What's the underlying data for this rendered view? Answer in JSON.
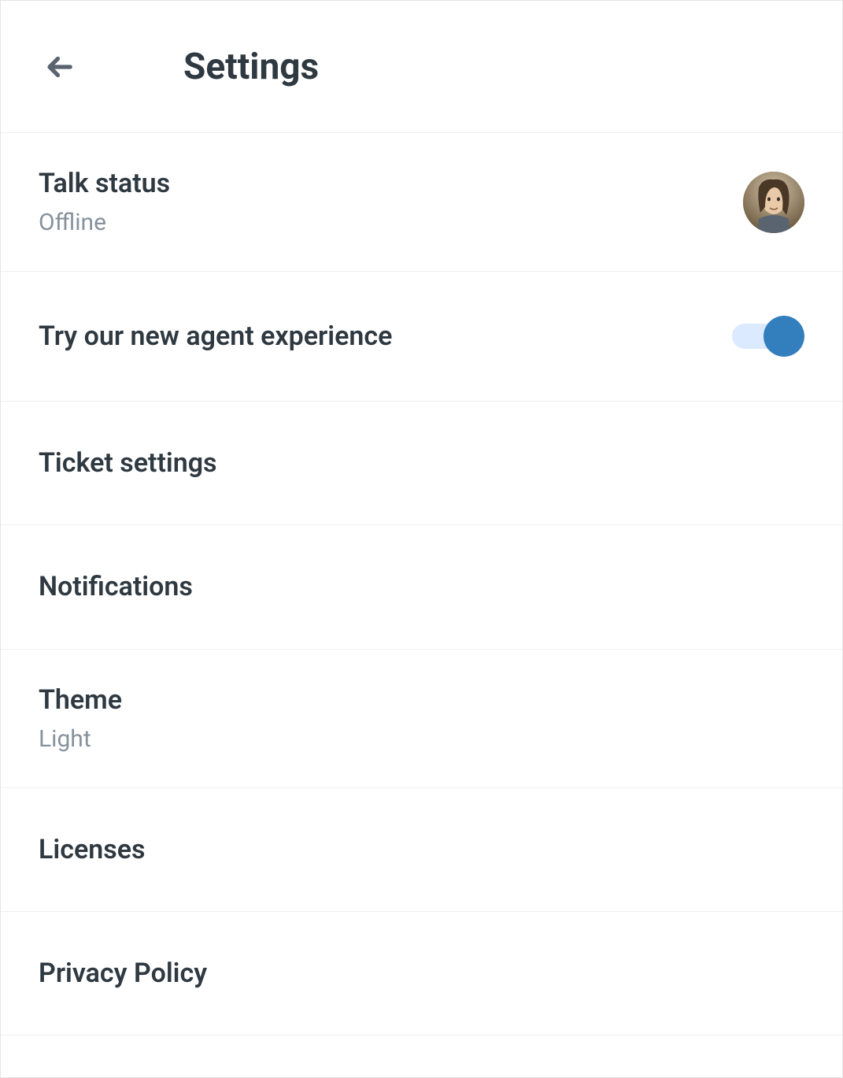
{
  "header": {
    "title": "Settings"
  },
  "items": {
    "talk_status": {
      "label": "Talk status",
      "value": "Offline"
    },
    "agent_experience": {
      "label": "Try our new agent experience",
      "enabled": true
    },
    "ticket_settings": {
      "label": "Ticket settings"
    },
    "notifications": {
      "label": "Notifications"
    },
    "theme": {
      "label": "Theme",
      "value": "Light"
    },
    "licenses": {
      "label": "Licenses"
    },
    "privacy_policy": {
      "label": "Privacy Policy"
    }
  }
}
